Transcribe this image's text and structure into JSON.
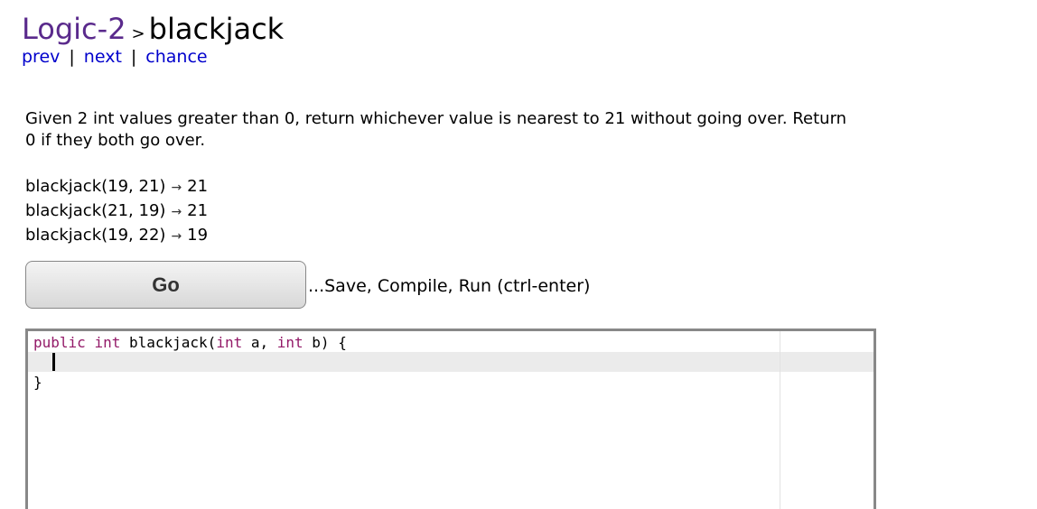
{
  "header": {
    "category": "Logic-2",
    "separator": ">",
    "problem": "blackjack"
  },
  "nav": {
    "prev": "prev",
    "next": "next",
    "chance": "chance",
    "divider": "|"
  },
  "description": "Given 2 int values greater than 0, return whichever value is nearest to 21 without going over. Return 0 if they both go over.",
  "examples": [
    {
      "call": "blackjack(19, 21)",
      "arrow": "→",
      "result": "21"
    },
    {
      "call": "blackjack(21, 19)",
      "arrow": "→",
      "result": "21"
    },
    {
      "call": "blackjack(19, 22)",
      "arrow": "→",
      "result": "19"
    }
  ],
  "go": {
    "label": "Go",
    "hint": "...Save, Compile, Run (ctrl-enter)"
  },
  "editor": {
    "line1": {
      "kw1": "public",
      "kw2": "int",
      "name": " blackjack(",
      "kw3": "int",
      "p1": " a, ",
      "kw4": "int",
      "p2": " b) {"
    },
    "line2": "  ",
    "line3": "}"
  }
}
